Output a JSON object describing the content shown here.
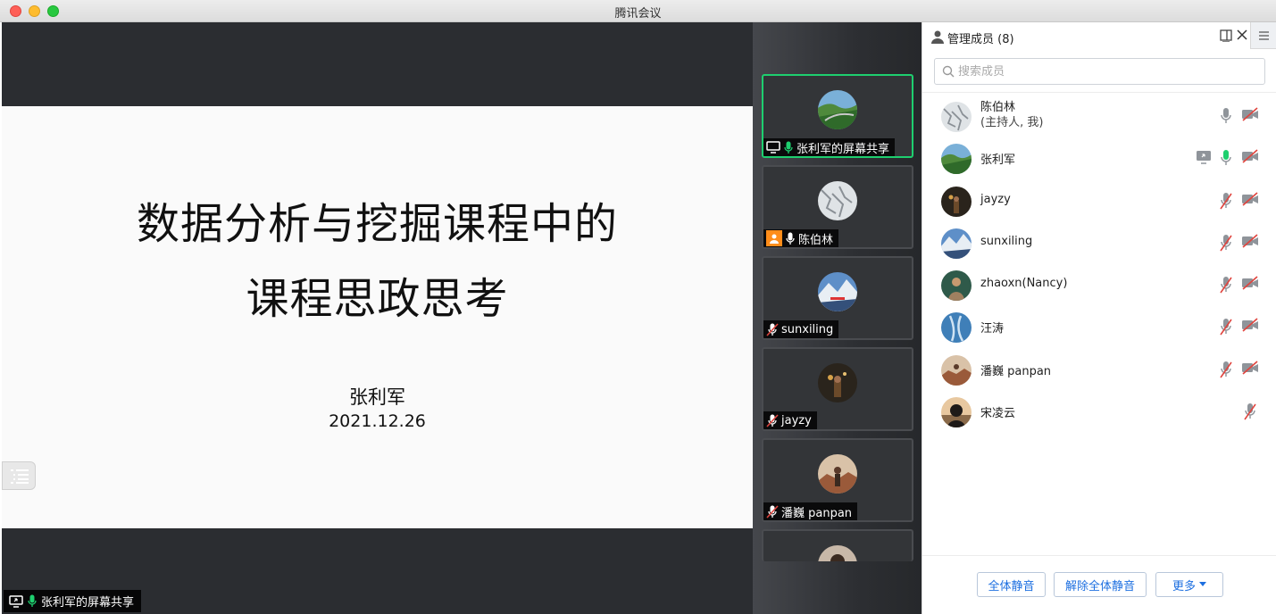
{
  "window": {
    "title": "腾讯会议"
  },
  "slide": {
    "title_line1": "数据分析与挖掘课程中的",
    "title_line2": "课程思政思考",
    "author": "张利军",
    "date": "2021.12.26"
  },
  "stage": {
    "share_label": "张利军的屏幕共享"
  },
  "video_tiles": [
    {
      "label": "张利军的屏幕共享",
      "active": true
    },
    {
      "label": "陈伯林"
    },
    {
      "label": "sunxiling"
    },
    {
      "label": "jayzy"
    },
    {
      "label": "潘巍 panpan"
    }
  ],
  "panel": {
    "title": "管理成员 (8)",
    "search_placeholder": "搜索成员",
    "members": [
      {
        "name": "陈伯林",
        "sub": "(主持人, 我)",
        "mic": "on",
        "cam": "off"
      },
      {
        "name": "张利军",
        "mic": "active",
        "cam": "off",
        "sharing": true
      },
      {
        "name": "jayzy",
        "mic": "muted",
        "cam": "off"
      },
      {
        "name": "sunxiling",
        "mic": "muted",
        "cam": "off"
      },
      {
        "name": "zhaoxn(Nancy)",
        "mic": "muted",
        "cam": "off"
      },
      {
        "name": "汪涛",
        "mic": "muted",
        "cam": "off"
      },
      {
        "name": "潘巍 panpan",
        "mic": "muted",
        "cam": "off"
      },
      {
        "name": "宋凌云",
        "mic": "muted"
      }
    ],
    "footer": {
      "mute_all": "全体静音",
      "unmute_all": "解除全体静音",
      "more": "更多"
    }
  },
  "colors": {
    "accent_green": "#1ecf6f",
    "mute_red": "#e0443e",
    "link_blue": "#1d6fe0"
  }
}
